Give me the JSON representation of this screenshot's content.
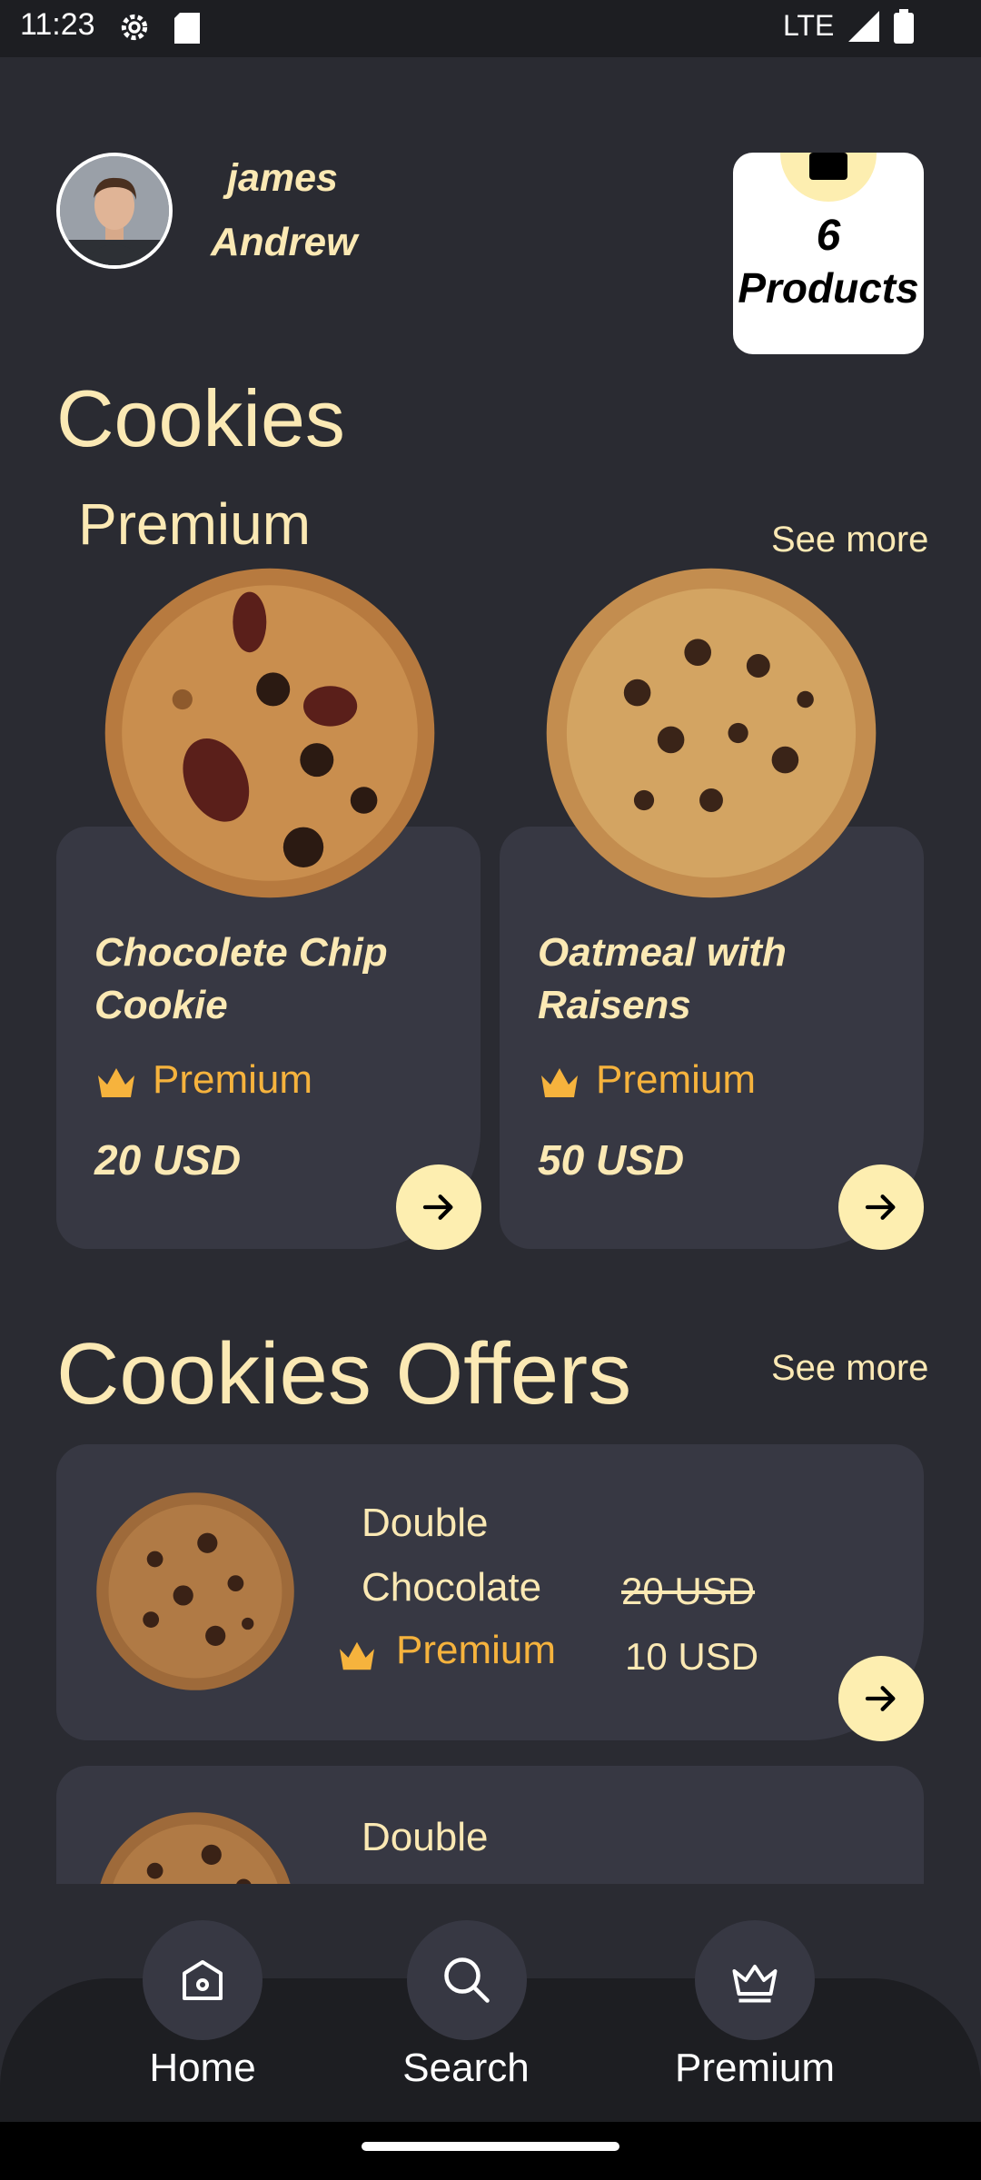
{
  "status_bar": {
    "time": "11:23",
    "network": "LTE"
  },
  "user": {
    "first_name": "james",
    "last_name": "Andrew"
  },
  "products_badge": {
    "count": "6",
    "label": "Products"
  },
  "section_cookies": {
    "title": "Cookies",
    "subtitle": "Premium",
    "see_more": "See more"
  },
  "premium_cards": [
    {
      "title_line1": "Chocolete Chip",
      "title_line2": "Cookie",
      "badge": "Premium",
      "price": "20 USD"
    },
    {
      "title_line1": "Oatmeal with",
      "title_line2": "Raisens",
      "badge": "Premium",
      "price": "50 USD"
    }
  ],
  "section_offers": {
    "title": "Cookies Offers",
    "see_more": "See more"
  },
  "offer_cards": [
    {
      "line1": "Double",
      "line2": "Chocolate",
      "badge": "Premium",
      "old_price": "20 USD",
      "new_price": "10 USD"
    },
    {
      "line1": "Double"
    }
  ],
  "bottom_nav": [
    {
      "label": "Home",
      "icon": "home-icon"
    },
    {
      "label": "Search",
      "icon": "search-icon"
    },
    {
      "label": "Premium",
      "icon": "crown-icon"
    }
  ],
  "colors": {
    "background": "#2a2b32",
    "card": "#373843",
    "accent": "#fdeeb0",
    "premium": "#f6b33d",
    "text": "#fbe9b4"
  }
}
